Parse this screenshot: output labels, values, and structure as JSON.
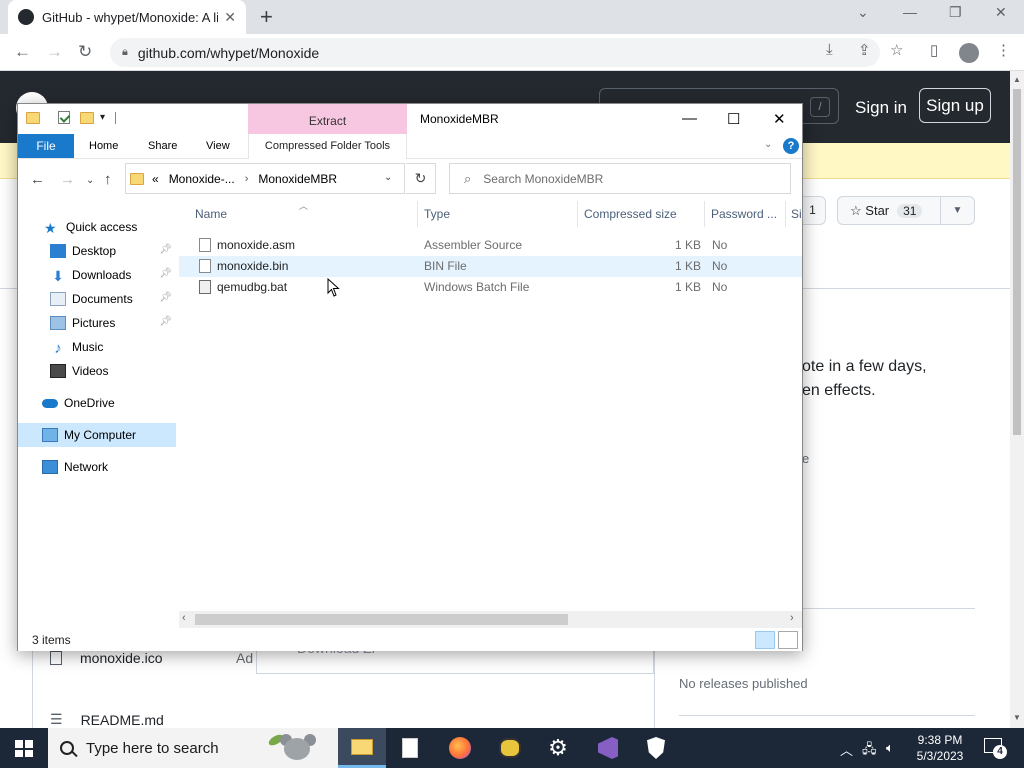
{
  "browser": {
    "tab_title": "GitHub - whypet/Monoxide: A lit",
    "url": "github.com/whypet/Monoxide"
  },
  "github": {
    "sign_in": "Sign in",
    "sign_up": "Sign up",
    "search_shortcut": "/",
    "fork_count_partial": "1",
    "star_label": "Star",
    "star_count": "31",
    "about_line1": "ote in a few days,",
    "about_line2": "en effects.",
    "about_small": "e",
    "no_releases": "No releases published",
    "files": [
      {
        "name": "monoxide.ico",
        "extra": "Ad"
      },
      {
        "name": "README.md"
      }
    ],
    "download_zip": "Download Zi"
  },
  "explorer": {
    "extract_tab": "Extract",
    "window_title": "MonoxideMBR",
    "ribbon": {
      "file": "File",
      "home": "Home",
      "share": "Share",
      "view": "View",
      "compressed_tools": "Compressed Folder Tools"
    },
    "address": {
      "overflow": "«",
      "crumb1": "Monoxide-...",
      "crumb2": "MonoxideMBR"
    },
    "search_placeholder": "Search MonoxideMBR",
    "nav": {
      "quick_access": "Quick access",
      "desktop": "Desktop",
      "downloads": "Downloads",
      "documents": "Documents",
      "pictures": "Pictures",
      "music": "Music",
      "videos": "Videos",
      "onedrive": "OneDrive",
      "my_computer": "My Computer",
      "network": "Network"
    },
    "columns": {
      "name": "Name",
      "type": "Type",
      "compressed_size": "Compressed size",
      "password": "Password ...",
      "size_partial": "Si"
    },
    "files": [
      {
        "name": "monoxide.asm",
        "type": "Assembler Source",
        "size": "1 KB",
        "password": "No"
      },
      {
        "name": "monoxide.bin",
        "type": "BIN File",
        "size": "1 KB",
        "password": "No"
      },
      {
        "name": "qemudbg.bat",
        "type": "Windows Batch File",
        "size": "1 KB",
        "password": "No"
      }
    ],
    "status": "3 items"
  },
  "taskbar": {
    "search_placeholder": "Type here to search",
    "time": "9:38 PM",
    "date": "5/3/2023",
    "notification_count": "4"
  },
  "colors": {
    "ribbon_accent": "#1979ca",
    "extract_tab": "#f7c7e1",
    "github_header": "#24292f",
    "taskbar": "#1c2738",
    "selection": "#cce8ff"
  }
}
